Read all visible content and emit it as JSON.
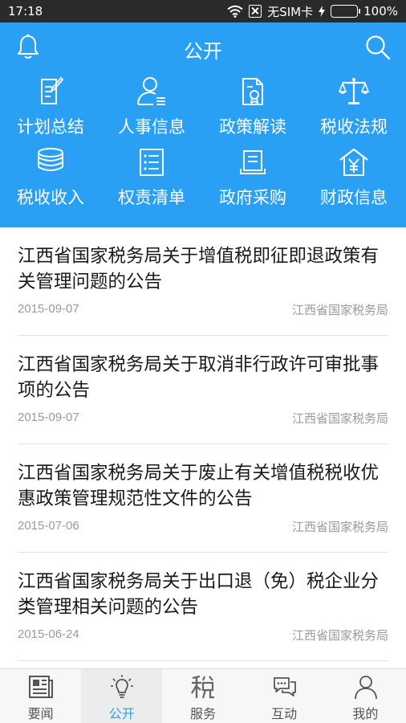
{
  "status": {
    "time": "17:18",
    "sim": "无SIM卡",
    "battery": "100%"
  },
  "header": {
    "title": "公开"
  },
  "grid": [
    {
      "label": "计划总结",
      "icon": "plan-document-icon"
    },
    {
      "label": "人事信息",
      "icon": "personnel-icon"
    },
    {
      "label": "政策解读",
      "icon": "policy-document-icon"
    },
    {
      "label": "税收法规",
      "icon": "scales-icon"
    },
    {
      "label": "税收收入",
      "icon": "coins-icon"
    },
    {
      "label": "权责清单",
      "icon": "checklist-icon"
    },
    {
      "label": "政府采购",
      "icon": "procurement-icon"
    },
    {
      "label": "财政信息",
      "icon": "finance-house-icon"
    }
  ],
  "news": [
    {
      "title": "江西省国家税务局关于增值税即征即退政策有关管理问题的公告",
      "date": "2015-09-07",
      "source": "江西省国家税务局"
    },
    {
      "title": "江西省国家税务局关于取消非行政许可审批事项的公告",
      "date": "2015-09-07",
      "source": "江西省国家税务局"
    },
    {
      "title": "江西省国家税务局关于废止有关增值税税收优惠政策管理规范性文件的公告",
      "date": "2015-07-06",
      "source": "江西省国家税务局"
    },
    {
      "title": "江西省国家税务局关于出口退（免）税企业分类管理相关问题的公告",
      "date": "2015-06-24",
      "source": "江西省国家税务局"
    }
  ],
  "tabs": [
    {
      "label": "要闻",
      "icon": "newspaper-icon",
      "active": false
    },
    {
      "label": "公开",
      "icon": "lightbulb-icon",
      "active": true
    },
    {
      "label": "服务",
      "icon": "tax-character-icon",
      "active": false
    },
    {
      "label": "互动",
      "icon": "chat-bubbles-icon",
      "active": false
    },
    {
      "label": "我的",
      "icon": "user-icon",
      "active": false
    }
  ],
  "colors": {
    "brand": "#2aa0f5",
    "statusbar": "#2a2a2a",
    "battery": "#3fd13f"
  }
}
